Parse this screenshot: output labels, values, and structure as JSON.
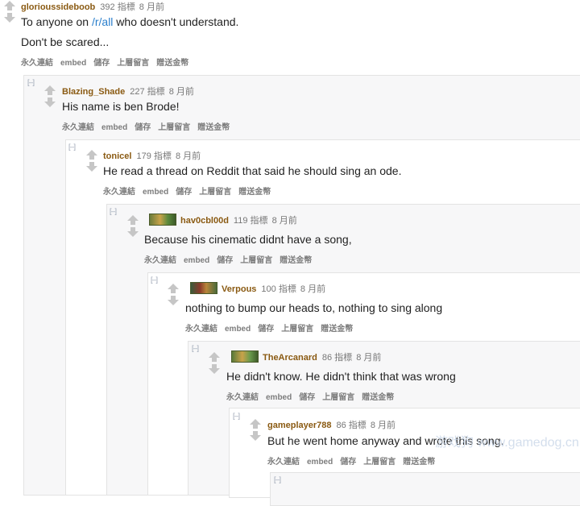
{
  "comments": [
    {
      "author": "glorioussideboob",
      "score": "392 指標",
      "time": "8 月前",
      "lines": [
        "To anyone on ",
        "/r/all",
        " who doesn't understand."
      ],
      "line2": "Don't be scared...",
      "buttons": [
        "永久連結",
        "embed",
        "儲存",
        "上層留言",
        "贈送金幣"
      ]
    },
    {
      "toggle": "[–]",
      "author": "Blazing_Shade",
      "score": "227 指標",
      "time": "8 月前",
      "text": "His name is ben Brode!",
      "buttons": [
        "永久連結",
        "embed",
        "儲存",
        "上層留言",
        "贈送金幣"
      ]
    },
    {
      "toggle": "[–]",
      "author": "tonicel",
      "score": "179 指標",
      "time": "8 月前",
      "text": "He read a thread on Reddit that said he should sing an ode.",
      "buttons": [
        "永久連結",
        "embed",
        "儲存",
        "上層留言",
        "贈送金幣"
      ]
    },
    {
      "toggle": "[–]",
      "author": "hav0cbl00d",
      "score": "119 指標",
      "time": "8 月前",
      "text": "Because his cinematic didnt have a song,",
      "buttons": [
        "永久連結",
        "embed",
        "儲存",
        "上層留言",
        "贈送金幣"
      ]
    },
    {
      "toggle": "[–]",
      "author": "Verpous",
      "score": "100 指標",
      "time": "8 月前",
      "text": "nothing to bump our heads to, nothing to sing along",
      "buttons": [
        "永久連結",
        "embed",
        "儲存",
        "上層留言",
        "贈送金幣"
      ]
    },
    {
      "toggle": "[–]",
      "author": "TheArcanard",
      "score": "86 指標",
      "time": "8 月前",
      "text": "He didn't know. He didn't think that was wrong",
      "buttons": [
        "永久連結",
        "embed",
        "儲存",
        "上層留言",
        "贈送金幣"
      ]
    },
    {
      "toggle": "[–]",
      "author": "gameplayer788",
      "score": "86 指標",
      "time": "8 月前",
      "text": "But he went home anyway and wrote this song.",
      "buttons": [
        "永久連結",
        "embed",
        "儲存",
        "上層留言",
        "贈送金幣"
      ]
    },
    {
      "toggle": "[–]"
    }
  ],
  "colors": {
    "author": "#8a5a12",
    "link": "#2a7fcc",
    "arrow": "#c6c6c6",
    "box_border": "#e3e3e3"
  },
  "watermark": "游戏狗 www.gamedog.cn"
}
